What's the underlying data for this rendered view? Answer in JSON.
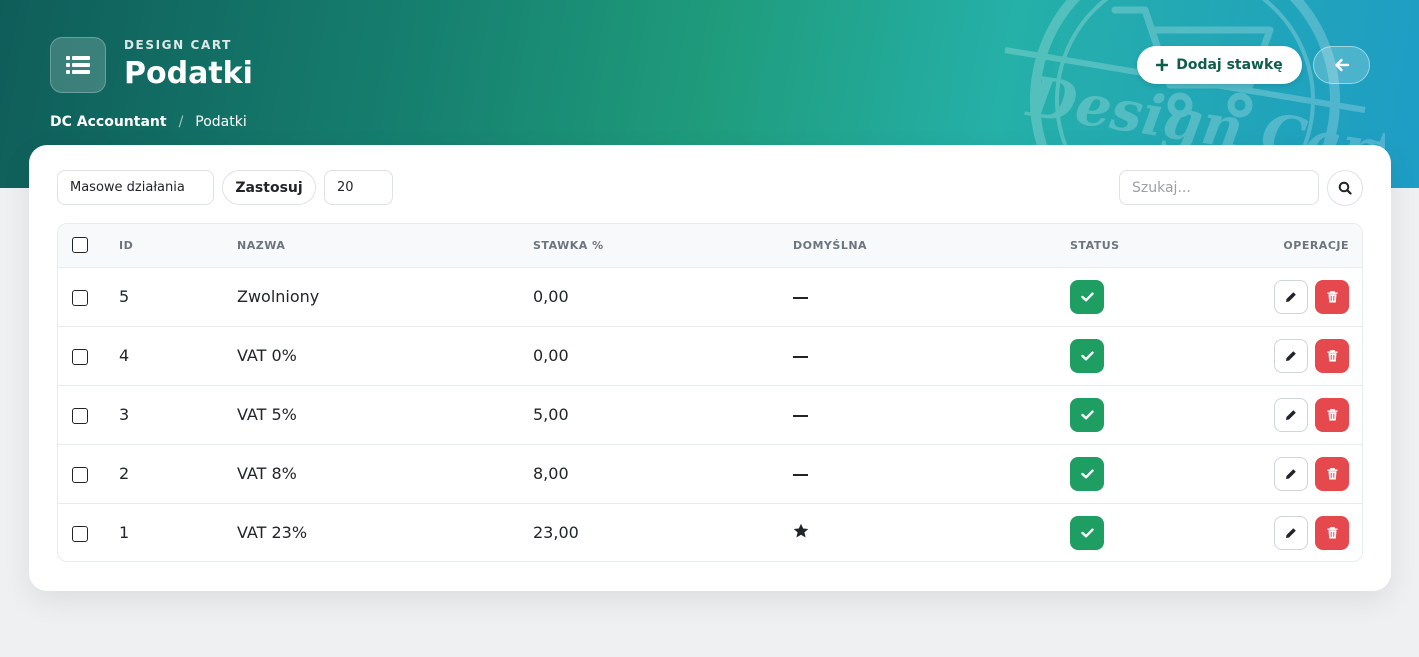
{
  "header": {
    "brand_sub": "DESIGN CART",
    "title": "Podatki",
    "breadcrumb": [
      {
        "label": "DC Accountant"
      },
      {
        "label": "Podatki"
      }
    ],
    "add_button_label": "Dodaj stawkę",
    "logo_text": "Design Cart"
  },
  "toolbar": {
    "bulk_actions_value": "Masowe działania",
    "apply_label": "Zastosuj",
    "per_page_value": "20",
    "search_placeholder": "Szukaj..."
  },
  "table": {
    "headers": {
      "id": "ID",
      "name": "NAZWA",
      "rate": "STAWKA %",
      "default": "DOMYŚLNA",
      "status": "STATUS",
      "ops": "OPERACJE"
    },
    "rows": [
      {
        "id": "5",
        "name": "Zwolniony",
        "rate": "0,00",
        "default": false,
        "status": "active"
      },
      {
        "id": "4",
        "name": "VAT 0%",
        "rate": "0,00",
        "default": false,
        "status": "active"
      },
      {
        "id": "3",
        "name": "VAT 5%",
        "rate": "5,00",
        "default": false,
        "status": "active"
      },
      {
        "id": "2",
        "name": "VAT 8%",
        "rate": "8,00",
        "default": false,
        "status": "active"
      },
      {
        "id": "1",
        "name": "VAT 23%",
        "rate": "23,00",
        "default": true,
        "status": "active"
      }
    ]
  },
  "colors": {
    "status_active": "#1e9e62",
    "danger": "#e5484d",
    "brand_dark": "#0f5d5a"
  },
  "icons": {
    "brand": "list-icon",
    "add": "plus-icon",
    "back": "arrow-left-icon",
    "search": "search-icon",
    "status": "check-icon",
    "edit": "pencil-icon",
    "delete": "trash-icon",
    "default": "star-icon"
  }
}
